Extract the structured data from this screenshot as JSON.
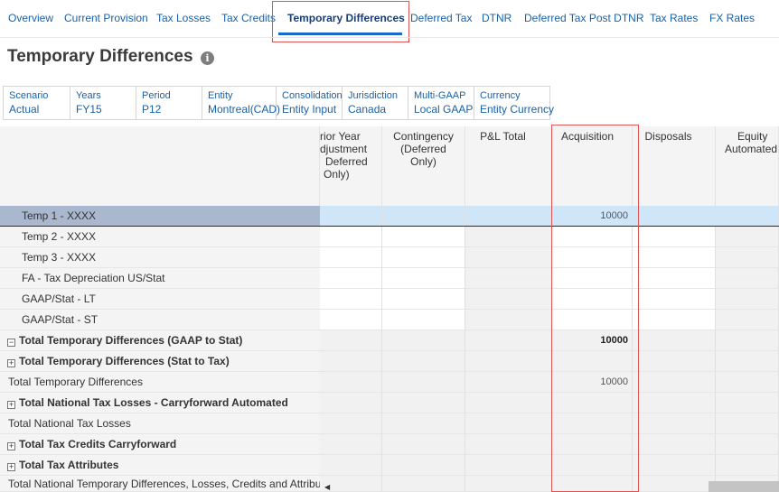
{
  "tabs": [
    {
      "label": "Overview"
    },
    {
      "label": "Current Provision"
    },
    {
      "label": "Tax Losses"
    },
    {
      "label": "Tax Credits"
    },
    {
      "label": "Temporary Differences",
      "active": true
    },
    {
      "label": "Deferred Tax"
    },
    {
      "label": "DTNR"
    },
    {
      "label": "Deferred Tax Post DTNR"
    },
    {
      "label": "Tax Rates"
    },
    {
      "label": "FX Rates"
    }
  ],
  "page": {
    "title": "Temporary Differences",
    "info_icon": "i"
  },
  "pov": [
    {
      "label": "Scenario",
      "value": "Actual"
    },
    {
      "label": "Years",
      "value": "FY15"
    },
    {
      "label": "Period",
      "value": "P12"
    },
    {
      "label": "Entity",
      "value": "Montreal(CAD)"
    },
    {
      "label": "Consolidation",
      "value": "Entity Input"
    },
    {
      "label": "Jurisdiction",
      "value": "Canada"
    },
    {
      "label": "Multi-GAAP",
      "value": "Local GAAP"
    },
    {
      "label": "Currency",
      "value": "Entity Currency"
    }
  ],
  "grid": {
    "columns": [
      {
        "lines": [
          "rior Year",
          "djustment",
          "Deferred",
          "Only)"
        ]
      },
      {
        "lines": [
          "Contingency",
          "(Deferred",
          "Only)"
        ]
      },
      {
        "lines": [
          "P&L Total"
        ]
      },
      {
        "lines": [
          "Acquisition"
        ]
      },
      {
        "lines": [
          "Disposals"
        ]
      },
      {
        "lines": [
          "Equity",
          "Automated"
        ]
      }
    ],
    "rows": [
      {
        "label": "Temp 1 - XXXX",
        "acquisition": "10000"
      },
      {
        "label": "Temp 2 - XXXX",
        "acquisition": ""
      },
      {
        "label": "Temp 3 - XXXX",
        "acquisition": ""
      },
      {
        "label": "FA - Tax Depreciation US/Stat",
        "acquisition": ""
      },
      {
        "label": "GAAP/Stat - LT",
        "acquisition": ""
      },
      {
        "label": "GAAP/Stat - ST",
        "acquisition": ""
      },
      {
        "label": "Total Temporary Differences (GAAP to Stat)",
        "acquisition": "10000",
        "expander": "⊟"
      },
      {
        "label": "Total Temporary Differences (Stat to Tax)",
        "acquisition": "",
        "expander": "⊞"
      },
      {
        "label": "Total Temporary Differences",
        "acquisition": "10000"
      },
      {
        "label": "Total National Tax Losses - Carryforward Automated",
        "acquisition": "",
        "expander": "⊞"
      },
      {
        "label": "Total National Tax Losses",
        "acquisition": ""
      },
      {
        "label": "Total Tax Credits Carryforward",
        "acquisition": "",
        "expander": "⊞"
      },
      {
        "label": "Total Tax Attributes",
        "acquisition": "",
        "expander": "⊞"
      },
      {
        "label": "Total National Temporary Differences, Losses, Credits and Attributes",
        "acquisition": ""
      }
    ]
  }
}
